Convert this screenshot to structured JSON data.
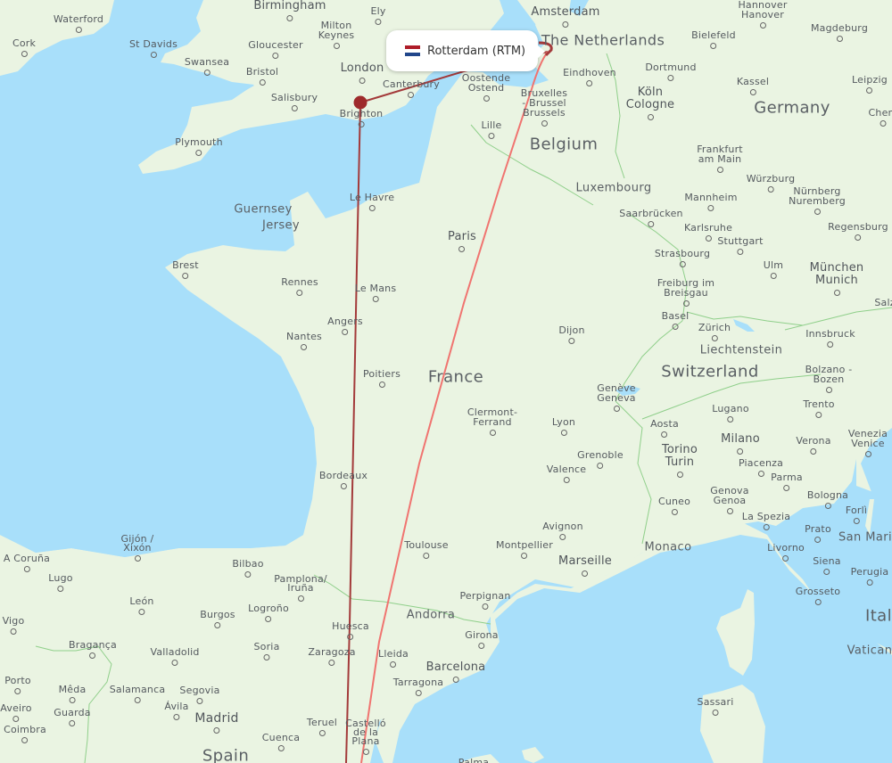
{
  "tooltip": {
    "label": "Rotterdam (RTM)",
    "flag": "netherlands-flag",
    "flag_colors": [
      "#ae1c28",
      "#ffffff",
      "#21468b"
    ]
  },
  "routes": {
    "color_dark": "#a33a3a",
    "color_light": "#f07470",
    "origin_marker_color": "#9e2a2b",
    "endpoints": [
      "Rotterdam",
      "Brighton",
      "Castelló de la Plana"
    ]
  },
  "countries": [
    {
      "id": "netherlands",
      "label": "The Netherlands"
    },
    {
      "id": "germany",
      "label": "Germany"
    },
    {
      "id": "belgium",
      "label": "Belgium"
    },
    {
      "id": "france",
      "label": "France"
    },
    {
      "id": "switzerland",
      "label": "Switzerland"
    },
    {
      "id": "spain",
      "label": "Spain"
    },
    {
      "id": "italy",
      "label": "Ital"
    },
    {
      "id": "luxembourg",
      "label": "Luxembourg"
    },
    {
      "id": "liechtenstein",
      "label": "Liechtenstein"
    },
    {
      "id": "andorra",
      "label": "Andorra"
    },
    {
      "id": "monaco",
      "label": "Monaco"
    },
    {
      "id": "san-marino",
      "label": "San Mari"
    },
    {
      "id": "vatican",
      "label": "Vatican"
    },
    {
      "id": "guernsey",
      "label": "Guernsey"
    },
    {
      "id": "jersey",
      "label": "Jersey"
    }
  ],
  "cities": [
    {
      "label": "Waterford"
    },
    {
      "label": "Cork"
    },
    {
      "label": "St Davids"
    },
    {
      "label": "Swansea"
    },
    {
      "label": "Birmingham"
    },
    {
      "label": "Gloucester"
    },
    {
      "label": "Bristol"
    },
    {
      "label": "Salisbury"
    },
    {
      "label": "Plymouth"
    },
    {
      "label": "Milton Keynes"
    },
    {
      "label": "Ely"
    },
    {
      "label": "London"
    },
    {
      "label": "Canterbury"
    },
    {
      "label": "Brighton"
    },
    {
      "label": "Amsterdam"
    },
    {
      "label": "Oostende Ostend"
    },
    {
      "label": "Bruxelles - Brussel Brussels"
    },
    {
      "label": "Lille"
    },
    {
      "label": "Eindhoven"
    },
    {
      "label": "Dortmund"
    },
    {
      "label": "Köln Cologne"
    },
    {
      "label": "Bielefeld"
    },
    {
      "label": "Hannover Hanover"
    },
    {
      "label": "Magdeburg"
    },
    {
      "label": "Kassel"
    },
    {
      "label": "Leipzig"
    },
    {
      "label": "Chem"
    },
    {
      "label": "Frankfurt am Main"
    },
    {
      "label": "Würzburg"
    },
    {
      "label": "Mannheim"
    },
    {
      "label": "Nürnberg Nuremberg"
    },
    {
      "label": "Saarbrücken"
    },
    {
      "label": "Karlsruhe"
    },
    {
      "label": "Stuttgart"
    },
    {
      "label": "Regensburg"
    },
    {
      "label": "Strasbourg"
    },
    {
      "label": "Ulm"
    },
    {
      "label": "München Munich"
    },
    {
      "label": "Freiburg im Breisgau"
    },
    {
      "label": "Basel"
    },
    {
      "label": "Zürich"
    },
    {
      "label": "Innsbruck"
    },
    {
      "label": "Salz"
    },
    {
      "label": "Bolzano - Bozen"
    },
    {
      "label": "Dijon"
    },
    {
      "label": "Genève Geneva"
    },
    {
      "label": "Le Havre"
    },
    {
      "label": "Paris"
    },
    {
      "label": "Rennes"
    },
    {
      "label": "Le Mans"
    },
    {
      "label": "Brest"
    },
    {
      "label": "Angers"
    },
    {
      "label": "Nantes"
    },
    {
      "label": "Poitiers"
    },
    {
      "label": "Clermont-Ferrand"
    },
    {
      "label": "Lyon"
    },
    {
      "label": "Grenoble"
    },
    {
      "label": "Valence"
    },
    {
      "label": "Bordeaux"
    },
    {
      "label": "Avignon"
    },
    {
      "label": "Toulouse"
    },
    {
      "label": "Montpellier"
    },
    {
      "label": "Marseille"
    },
    {
      "label": "Perpignan"
    },
    {
      "label": "Trento"
    },
    {
      "label": "Lugano"
    },
    {
      "label": "Aosta"
    },
    {
      "label": "Milano"
    },
    {
      "label": "Verona"
    },
    {
      "label": "Venezia Venice"
    },
    {
      "label": "Torino Turin"
    },
    {
      "label": "Piacenza"
    },
    {
      "label": "Parma"
    },
    {
      "label": "Genova Genoa"
    },
    {
      "label": "Bologna"
    },
    {
      "label": "Cuneo"
    },
    {
      "label": "Forlì"
    },
    {
      "label": "La Spezia"
    },
    {
      "label": "Prato"
    },
    {
      "label": "Livorno"
    },
    {
      "label": "Siena"
    },
    {
      "label": "Perugia"
    },
    {
      "label": "Grosseto"
    },
    {
      "label": "Sassari"
    },
    {
      "label": "Gijón / Xixón"
    },
    {
      "label": "A Coruña"
    },
    {
      "label": "Lugo"
    },
    {
      "label": "Bilbao"
    },
    {
      "label": "Pamplona/ Iruña"
    },
    {
      "label": "León"
    },
    {
      "label": "Burgos"
    },
    {
      "label": "Logroño"
    },
    {
      "label": "Vigo"
    },
    {
      "label": "Bragança"
    },
    {
      "label": "Valladolid"
    },
    {
      "label": "Soria"
    },
    {
      "label": "Huesca"
    },
    {
      "label": "Zaragoza"
    },
    {
      "label": "Lleida"
    },
    {
      "label": "Girona"
    },
    {
      "label": "Barcelona"
    },
    {
      "label": "Tarragona"
    },
    {
      "label": "Porto"
    },
    {
      "label": "Mêda"
    },
    {
      "label": "Salamanca"
    },
    {
      "label": "Segovia"
    },
    {
      "label": "Aveiro"
    },
    {
      "label": "Guarda"
    },
    {
      "label": "Ávila"
    },
    {
      "label": "Madrid"
    },
    {
      "label": "Coimbra"
    },
    {
      "label": "Cuenca"
    },
    {
      "label": "Teruel"
    },
    {
      "label": "Castelló de la Plana"
    },
    {
      "label": "Palma"
    }
  ]
}
